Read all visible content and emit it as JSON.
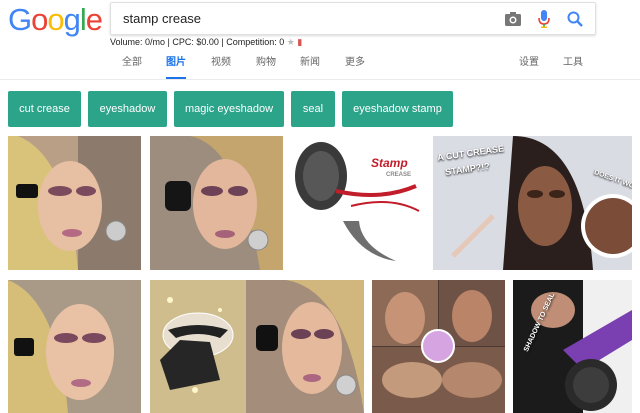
{
  "logo": {
    "letters": [
      "G",
      "o",
      "o",
      "g",
      "l",
      "e"
    ],
    "colors": [
      "#4285f4",
      "#ea4335",
      "#fbbc05",
      "#4285f4",
      "#34a853",
      "#ea4335"
    ]
  },
  "search": {
    "query": "stamp crease"
  },
  "seo_bar": {
    "text": "Volume: 0/mo | CPC: $0.00 | Competition: 0"
  },
  "tabs": [
    "全部",
    "图片",
    "视频",
    "购物",
    "新闻",
    "更多"
  ],
  "active_tab": "图片",
  "right_tabs": [
    "设置",
    "工具"
  ],
  "chips": [
    "cut crease",
    "eyeshadow",
    "magic eyeshadow",
    "seal",
    "eyeshadow stamp"
  ],
  "colors": {
    "chip_bg": "#2ba48a",
    "active_tab": "#1a73e8"
  },
  "results": {
    "stamp_logo_text": "Stamp",
    "stamp_logo_sub": "CREASE",
    "youtube_caption_1": "A CUT CREASE",
    "youtube_caption_2": "STAMP?!?",
    "youtube_caption_3": "DOES IT WO",
    "box_caption": "SHADOW TO SEAL"
  }
}
